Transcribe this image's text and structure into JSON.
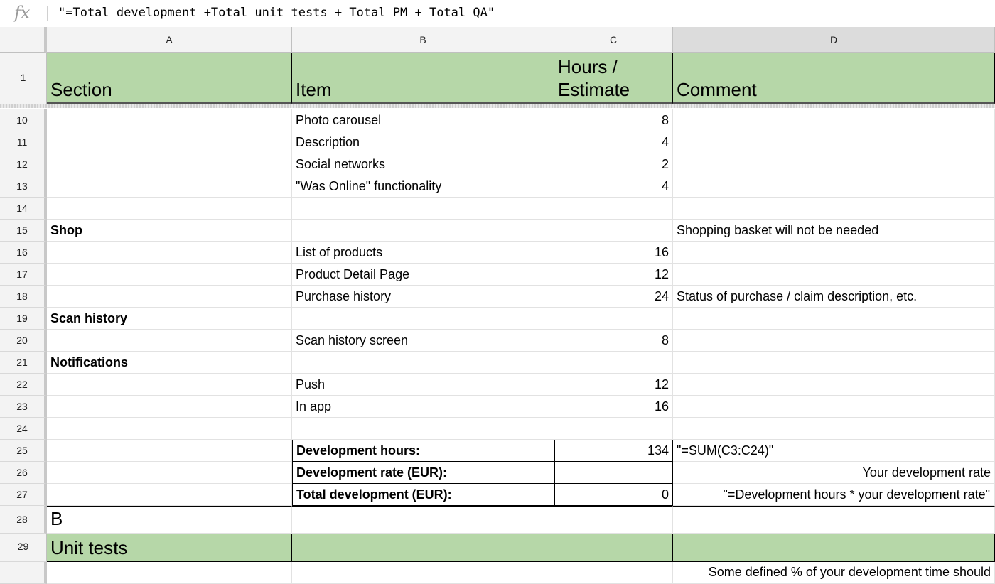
{
  "formula_bar": {
    "fx_label": "fx",
    "formula": "\"=Total development +Total unit tests + Total PM + Total QA\""
  },
  "columns": [
    "A",
    "B",
    "C",
    "D"
  ],
  "header_row": {
    "number": "1",
    "a": "Section",
    "b": "Item",
    "c": "Hours / Estimate",
    "d": "Comment"
  },
  "rows": [
    {
      "n": "10",
      "a": "",
      "b": "Photo carousel",
      "c": "8",
      "d": ""
    },
    {
      "n": "11",
      "a": "",
      "b": "Description",
      "c": "4",
      "d": ""
    },
    {
      "n": "12",
      "a": "",
      "b": "Social networks",
      "c": "2",
      "d": ""
    },
    {
      "n": "13",
      "a": "",
      "b": "\"Was Online\" functionality",
      "c": "4",
      "d": ""
    },
    {
      "n": "14",
      "a": "",
      "b": "",
      "c": "",
      "d": ""
    },
    {
      "n": "15",
      "a": "Shop",
      "b": "",
      "c": "",
      "d": "Shopping basket will not be needed"
    },
    {
      "n": "16",
      "a": "",
      "b": "List of products",
      "c": "16",
      "d": ""
    },
    {
      "n": "17",
      "a": "",
      "b": "Product Detail Page",
      "c": "12",
      "d": ""
    },
    {
      "n": "18",
      "a": "",
      "b": "Purchase history",
      "c": "24",
      "d": "Status of purchase / claim description, etc."
    },
    {
      "n": "19",
      "a": "Scan history",
      "b": "",
      "c": "",
      "d": ""
    },
    {
      "n": "20",
      "a": "",
      "b": "Scan history screen",
      "c": "8",
      "d": ""
    },
    {
      "n": "21",
      "a": "Notifications",
      "b": "",
      "c": "",
      "d": ""
    },
    {
      "n": "22",
      "a": "",
      "b": "Push",
      "c": "12",
      "d": ""
    },
    {
      "n": "23",
      "a": "",
      "b": "In app",
      "c": "16",
      "d": ""
    },
    {
      "n": "24",
      "a": "",
      "b": "",
      "c": "",
      "d": ""
    },
    {
      "n": "25",
      "a": "",
      "b": "Development hours:",
      "c": "134",
      "d": "\"=SUM(C3:C24)\""
    },
    {
      "n": "26",
      "a": "",
      "b": "Development rate (EUR):",
      "c": "",
      "d": "Your development rate"
    },
    {
      "n": "27",
      "a": "",
      "b": "Total development (EUR):",
      "c": "0",
      "d": "\"=Development hours * your development rate\""
    },
    {
      "n": "28",
      "a": "B",
      "b": "",
      "c": "",
      "d": ""
    },
    {
      "n": "29",
      "a": "Unit tests",
      "b": "",
      "c": "",
      "d": ""
    },
    {
      "n": "",
      "a": "",
      "b": "",
      "c": "",
      "d": "Some defined % of your development time should"
    }
  ],
  "colors": {
    "header_green": "#b6d7a8",
    "gridline": "#e2e2e2",
    "header_gray": "#f3f3f3",
    "selected_column": "#dcdcdc"
  }
}
